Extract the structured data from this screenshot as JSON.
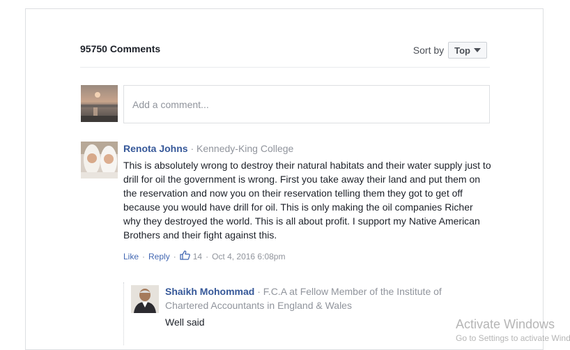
{
  "header": {
    "comment_count": "95750 Comments",
    "sort_label": "Sort by",
    "sort_value": "Top"
  },
  "composer": {
    "placeholder": "Add a comment..."
  },
  "comments": [
    {
      "author": "Renota Johns",
      "meta": " · Kennedy-King College",
      "text": "This is absolutely wrong to destroy their natural habitats and their water supply just to drill for oil the government is wrong. First you take away their land and put them on the reservation and now you on their reservation telling them they got to get off because you would have drill for oil. This is only making the oil companies Richer why they destroyed the world. This is all about profit. I support my Native American Brothers and their fight against this.",
      "like_label": "Like",
      "reply_label": "Reply",
      "like_count": "14",
      "timestamp": "Oct 4, 2016 6:08pm",
      "replies": [
        {
          "author": "Shaikh Mohommad",
          "meta": " · F.C.A at Fellow Member of the Institute of Chartered Accountants in England & Wales",
          "text": "Well said"
        }
      ]
    }
  ],
  "watermark": {
    "title": "Activate Windows",
    "subtitle": "Go to Settings to activate Windows."
  }
}
